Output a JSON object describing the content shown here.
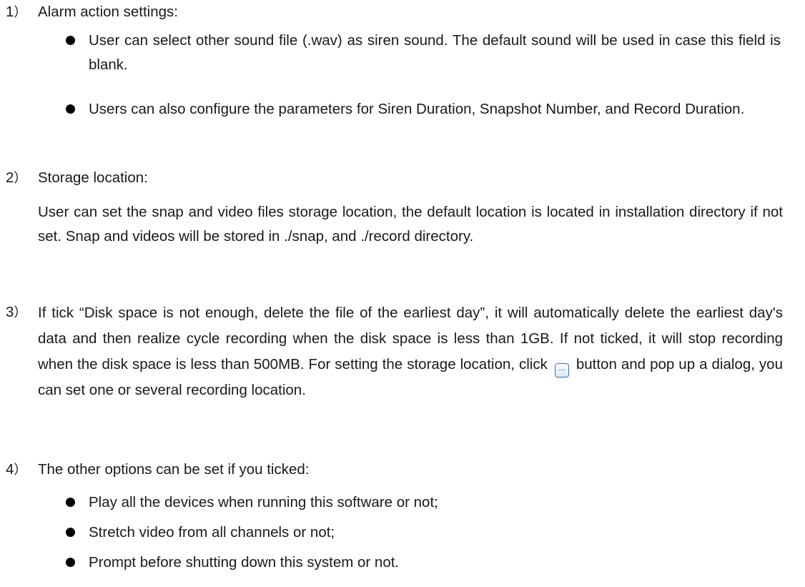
{
  "items": [
    {
      "number": "1",
      "paren": "）",
      "heading": "Alarm action settings:",
      "bullets": [
        "User can select other sound file (.wav) as siren sound. The default sound will be used in case this field is blank.",
        "Users can also configure the parameters for Siren Duration, Snapshot Number, and Record Duration."
      ]
    },
    {
      "number": "2",
      "paren": "）",
      "heading": "Storage location:",
      "paragraph": "User can set the snap and video files storage location, the default location is located in installation directory if not set. Snap and videos will be stored in ./snap, and ./record directory."
    },
    {
      "number": "3",
      "paren": "）",
      "paragraph_part1": "If tick “Disk space is not enough, delete the file of the earliest day”, it will automatically delete the earliest day's data and then realize cycle recording when the disk space is less than 1GB. If not ticked, it will stop recording when the disk space is less than 500MB. For setting the storage location, click",
      "button_glyph": "...",
      "button_icon": "browse-button-icon",
      "paragraph_part2": "button and pop up a dialog, you can set one or several recording location."
    },
    {
      "number": "4",
      "paren": "）",
      "heading": "The other options can be set if you ticked:",
      "bullets": [
        "Play all the devices when running this software or not;",
        "Stretch video from all channels or not;",
        "Prompt before shutting down this system or not."
      ]
    }
  ]
}
